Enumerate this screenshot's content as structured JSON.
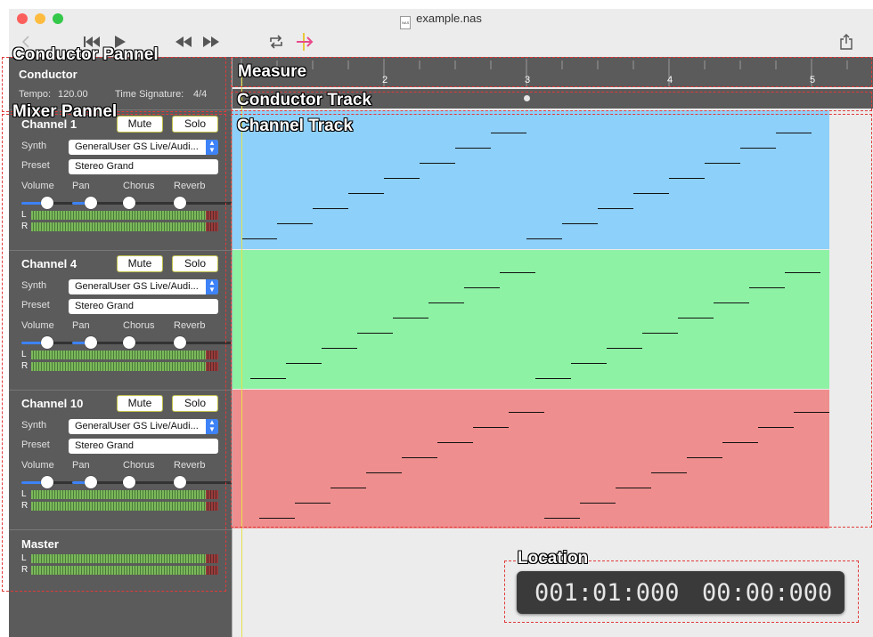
{
  "window": {
    "title": "example.nas",
    "doc_icon_text": "NAS"
  },
  "toolbar": {
    "back_icon": "chevron-left-icon",
    "rewind_start_icon": "skip-to-start-icon",
    "play_icon": "play-icon",
    "rewind_icon": "rewind-icon",
    "forward_icon": "fast-forward-icon",
    "loop_icon": "loop-icon",
    "follow_icon": "playhead-follow-icon",
    "share_icon": "share-icon"
  },
  "conductor": {
    "title": "Conductor",
    "tempo_label": "Tempo:",
    "tempo_value": "120.00",
    "timesig_label": "Time Signature:",
    "timesig_value": "4/4"
  },
  "channels": [
    {
      "name": "Channel 1",
      "mute": "Mute",
      "solo": "Solo",
      "synth_label": "Synth",
      "synth": "GeneralUser GS Live/Audi...",
      "preset_label": "Preset",
      "preset": "Stereo Grand",
      "volume_label": "Volume",
      "pan_label": "Pan",
      "chorus_label": "Chorus",
      "reverb_label": "Reverb",
      "l": "L",
      "r": "R",
      "volume": 0.8,
      "pan": 0.5,
      "chorus": 0.0,
      "reverb": 0.0,
      "color": "#8dd0fa"
    },
    {
      "name": "Channel 4",
      "mute": "Mute",
      "solo": "Solo",
      "synth_label": "Synth",
      "synth": "GeneralUser GS Live/Audi...",
      "preset_label": "Preset",
      "preset": "Stereo Grand",
      "volume_label": "Volume",
      "pan_label": "Pan",
      "chorus_label": "Chorus",
      "reverb_label": "Reverb",
      "l": "L",
      "r": "R",
      "volume": 0.8,
      "pan": 0.5,
      "chorus": 0.0,
      "reverb": 0.0,
      "color": "#8df2a4"
    },
    {
      "name": "Channel 10",
      "mute": "Mute",
      "solo": "Solo",
      "synth_label": "Synth",
      "synth": "GeneralUser GS Live/Audi...",
      "preset_label": "Preset",
      "preset": "Stereo Grand",
      "volume_label": "Volume",
      "pan_label": "Pan",
      "chorus_label": "Chorus",
      "reverb_label": "Reverb",
      "l": "L",
      "r": "R",
      "volume": 0.8,
      "pan": 0.5,
      "chorus": 0.0,
      "reverb": 0.0,
      "color": "#ef8e8e"
    }
  ],
  "master": {
    "name": "Master",
    "l": "L",
    "r": "R"
  },
  "ruler": {
    "measures": [
      "2",
      "3",
      "4",
      "5"
    ]
  },
  "location": {
    "measure": "001:01:000",
    "time": "00:00:000"
  },
  "annotations": {
    "conductor_panel": "Conductor Pannel",
    "mixer_panel": "Mixer Pannel",
    "measure": "Measure",
    "conductor_track": "Conductor Track",
    "channel_track": "Channel Track",
    "location": "Location"
  }
}
